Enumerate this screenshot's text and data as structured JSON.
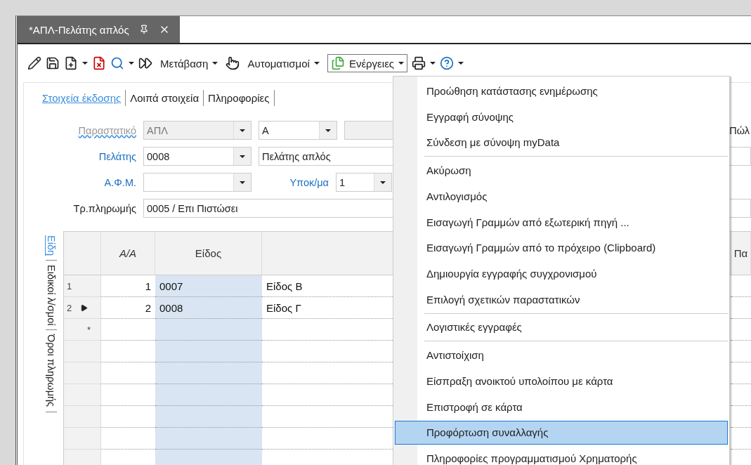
{
  "document_tab": {
    "title": "*ΑΠΛ-Πελάτης απλός"
  },
  "toolbar": {
    "menus": [
      {
        "label": "Μετάβαση",
        "open": false
      },
      {
        "label": "Αυτοματισμοί",
        "open": false
      },
      {
        "label": "Ενέργειες",
        "open": true
      }
    ]
  },
  "subtabs": [
    {
      "label": "Στοιχεία έκδοσης",
      "selected": true
    },
    {
      "label": "Λοιπά στοιχεία",
      "selected": false
    },
    {
      "label": "Πληροφορίες",
      "selected": false
    }
  ],
  "form": {
    "document": {
      "label": "Παραστατικό",
      "disabled": true,
      "type_value": "ΑΠΛ",
      "series_value": "Α"
    },
    "customer": {
      "label": "Πελάτης",
      "code": "0008",
      "name": "Πελάτης απλός"
    },
    "vat": {
      "label": "Α.Φ.Μ.",
      "branch_label": "Υποκ/μα",
      "branch_value": "1"
    },
    "payment": {
      "label": "Τρ.πληρωμής",
      "value": "0005 / Επι Πιστώσει"
    },
    "right_cut_label": "Πώλ"
  },
  "side_tabs": [
    {
      "label": "Είδη",
      "selected": true
    },
    {
      "label": "Ειδικοί λ/σμοί",
      "selected": false
    },
    {
      "label": "Όροι πληρωμής",
      "selected": false
    }
  ],
  "grid": {
    "header_aa": "A/A",
    "header_item": "Είδος",
    "header_cut": "Πα",
    "new_row_marker": "*",
    "rows": [
      {
        "row_number": "1",
        "current": false,
        "aa": "1",
        "code": "0007",
        "description": "Είδος Β"
      },
      {
        "row_number": "2",
        "current": true,
        "aa": "2",
        "code": "0008",
        "description": "Είδος Γ"
      }
    ]
  },
  "menu": {
    "groups": [
      [
        {
          "label": "Προώθηση κατάστασης ενημέρωσης",
          "selected": false
        },
        {
          "label": "Εγγραφή σύνοψης",
          "selected": false
        },
        {
          "label": "Σύνδεση με σύνοψη myData",
          "selected": false
        }
      ],
      [
        {
          "label": "Ακύρωση",
          "selected": false
        },
        {
          "label": "Αντιλογισμός",
          "selected": false
        },
        {
          "label": "Εισαγωγή Γραμμών από εξωτερική πηγή ...",
          "selected": false
        },
        {
          "label": "Εισαγωγή Γραμμών από το πρόχειρο (Clipboard)",
          "selected": false
        },
        {
          "label": "Δημιουργία εγγραφής συγχρονισμού",
          "selected": false
        },
        {
          "label": "Επιλογή σχετικών παραστατικών",
          "selected": false
        }
      ],
      [
        {
          "label": "Λογιστικές εγγραφές",
          "selected": false
        }
      ],
      [
        {
          "label": "Αντιστοίχιση",
          "selected": false
        },
        {
          "label": "Είσπραξη ανοικτού υπολοίπου με κάρτα",
          "selected": false
        },
        {
          "label": "Επιστροφή σε κάρτα",
          "selected": false
        },
        {
          "label": "Προφόρτωση συναλλαγής",
          "selected": true
        },
        {
          "label": "Πληροφορίες προγραμματισμού Χρηματορής",
          "selected": false
        }
      ]
    ]
  }
}
